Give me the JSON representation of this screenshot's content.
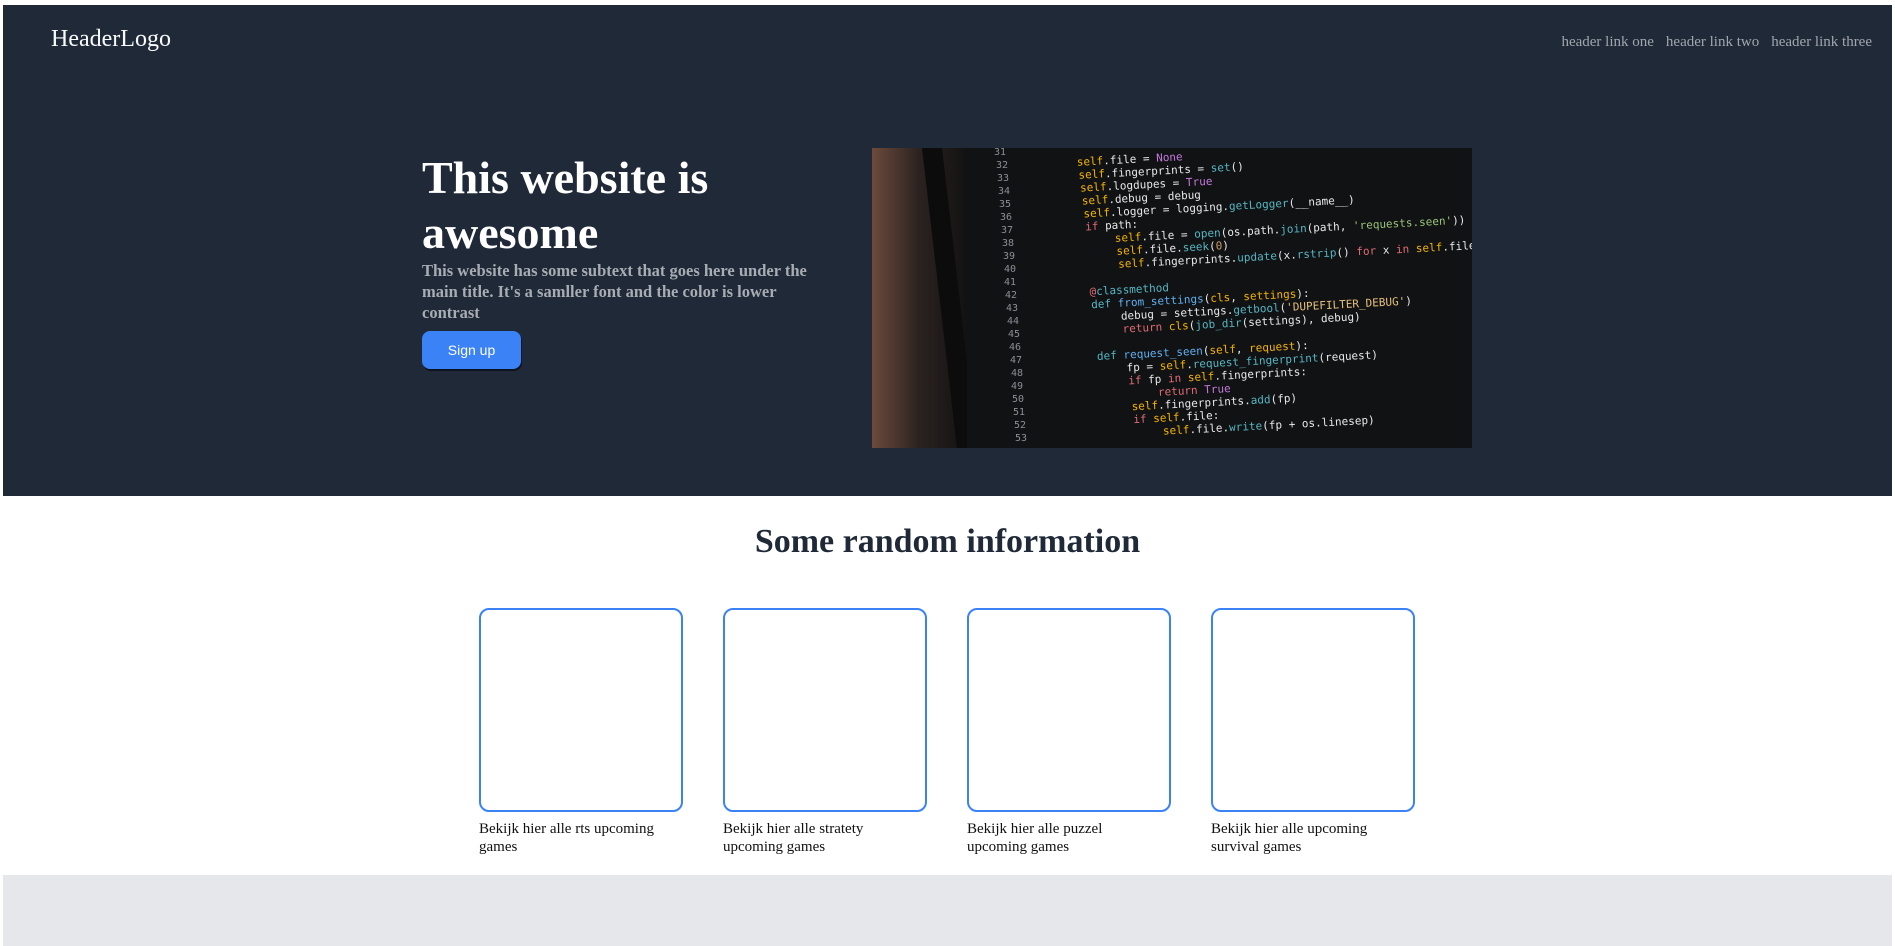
{
  "header": {
    "logo": "HeaderLogo",
    "links": [
      "header link one",
      "header link two",
      "header link three"
    ]
  },
  "hero": {
    "title": "This website is awesome",
    "subtitle": "This website has some subtext that goes here under the main title. It's a samller font and the color is lower contrast",
    "button_label": "Sign up"
  },
  "info": {
    "title": "Some random information",
    "cards": [
      {
        "label": "Bekijk hier alle rts upcoming games"
      },
      {
        "label": "Bekijk hier alle stratety upcoming games"
      },
      {
        "label": "Bekijk hier alle puzzel upcoming games"
      },
      {
        "label": "Bekijk hier alle upcoming survival games"
      }
    ]
  },
  "colors": {
    "hero_bg": "#1f2937",
    "accent": "#3b82f6",
    "footer_bg": "#e5e7eb"
  }
}
